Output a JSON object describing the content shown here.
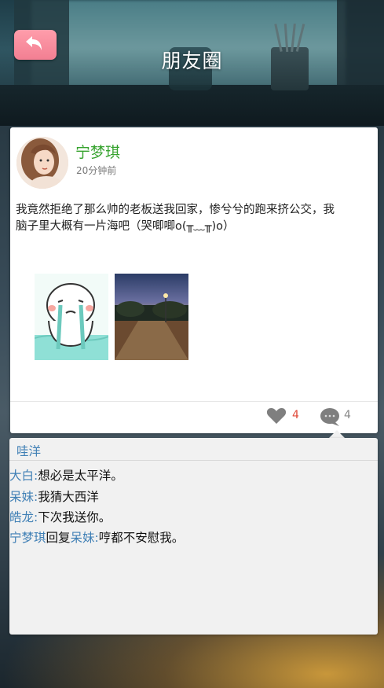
{
  "header": {
    "title": "朋友圈",
    "back_icon": "back-arrow-icon"
  },
  "post": {
    "author": "宁梦琪",
    "time": "20分钟前",
    "text": "我竟然拒绝了那么帅的老板送我回家，惨兮兮的跑来挤公交，我脑子里大概有一片海吧（哭唧唧o(╥﹏╥)o）",
    "images": [
      "crying-cartoon-image",
      "night-street-image"
    ],
    "like_count": "4",
    "comment_count": "4",
    "colors": {
      "author": "#37a32f",
      "like_count": "#e04a3a"
    }
  },
  "comments": {
    "likers": "哇洋",
    "items": [
      {
        "name": "大白",
        "sep": ":",
        "text": "想必是太平洋。"
      },
      {
        "name": "呆妹",
        "sep": ":",
        "text": "我猜大西洋"
      },
      {
        "name": "皓龙",
        "sep": ":",
        "text": "下次我送你。"
      }
    ],
    "reply": {
      "name": "宁梦琪",
      "verb": "回复",
      "target": "呆妹",
      "sep": ":",
      "text": "哼都不安慰我。"
    },
    "colors": {
      "name": "#3f7fb5"
    }
  }
}
